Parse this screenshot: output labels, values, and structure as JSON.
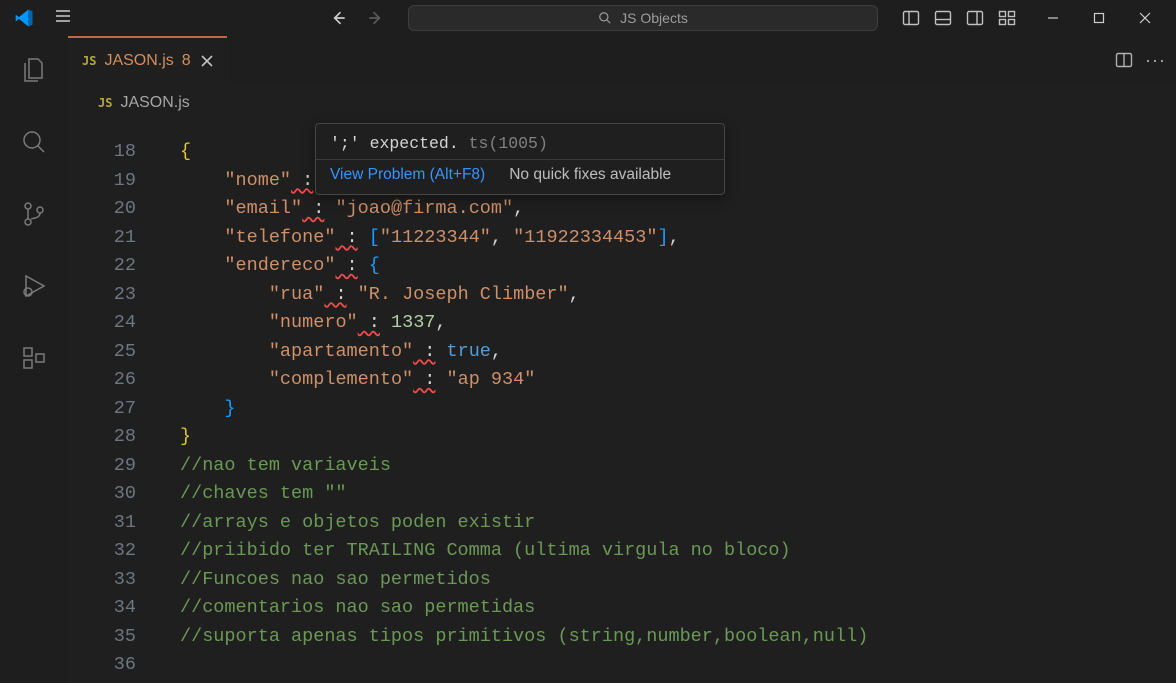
{
  "titlebar": {
    "command_center_label": "JS Objects"
  },
  "tab": {
    "filename": "JASON.js",
    "dirty_count": "8",
    "js_label": "JS"
  },
  "breadcrumb": {
    "js_label": "JS",
    "filename": "JASON.js"
  },
  "hover": {
    "msg_prefix": "';' expected.",
    "msg_code": "ts(1005)",
    "view_problem": "View Problem (Alt+F8)",
    "no_fixes": "No quick fixes available"
  },
  "line_numbers": [
    "18",
    "19",
    "20",
    "21",
    "22",
    "23",
    "24",
    "25",
    "26",
    "27",
    "28",
    "29",
    "30",
    "31",
    "32",
    "33",
    "34",
    "35",
    "36"
  ],
  "code": {
    "l18_brace": "{",
    "l19_key": "\"nome\"",
    "l19_colon": " :",
    "l20_key": "\"email\"",
    "l20_val": "\"joao@firma.com\"",
    "l21_key": "\"telefone\"",
    "l21_a": "\"11223344\"",
    "l21_b": "\"11922334453\"",
    "l22_key": "\"endereco\"",
    "l23_key": "\"rua\"",
    "l23_val": "\"R. Joseph Climber\"",
    "l24_key": "\"numero\"",
    "l24_val": "1337",
    "l25_key": "\"apartamento\"",
    "l25_val": "true",
    "l26_key": "\"complemento\"",
    "l26_val": "\"ap 934\"",
    "l27_brace": "}",
    "l28_brace": "}",
    "l29": "//nao tem variaveis",
    "l30": "//chaves tem \"\"",
    "l31": "//arrays e objetos poden existir",
    "l32": "//priibido ter TRAILING Comma (ultima virgula no bloco)",
    "l33": "//Funcoes nao sao permetidos",
    "l34": "//comentarios nao sao permetidas",
    "l35": "//suporta apenas tipos primitivos (string,number,boolean,null)"
  }
}
